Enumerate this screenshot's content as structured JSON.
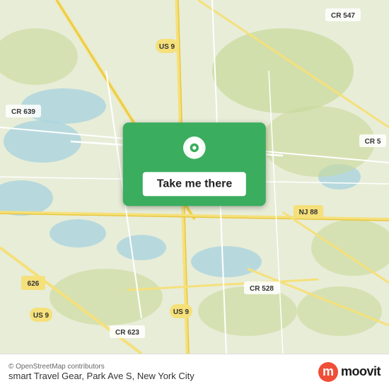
{
  "map": {
    "attribution": "© OpenStreetMap contributors",
    "background_color": "#e8f0d8"
  },
  "button": {
    "label": "Take me there",
    "pin_icon": "location-pin"
  },
  "footer": {
    "copyright": "© OpenStreetMap contributors",
    "location": "smart Travel Gear, Park Ave S, New York City",
    "brand": "moovit",
    "brand_initial": "m"
  },
  "road_labels": [
    "CR 547",
    "US 9",
    "CR 639",
    "NJ 88",
    "CR 528",
    "US 9",
    "US 9",
    "CR 623",
    "626",
    "CR 5"
  ]
}
